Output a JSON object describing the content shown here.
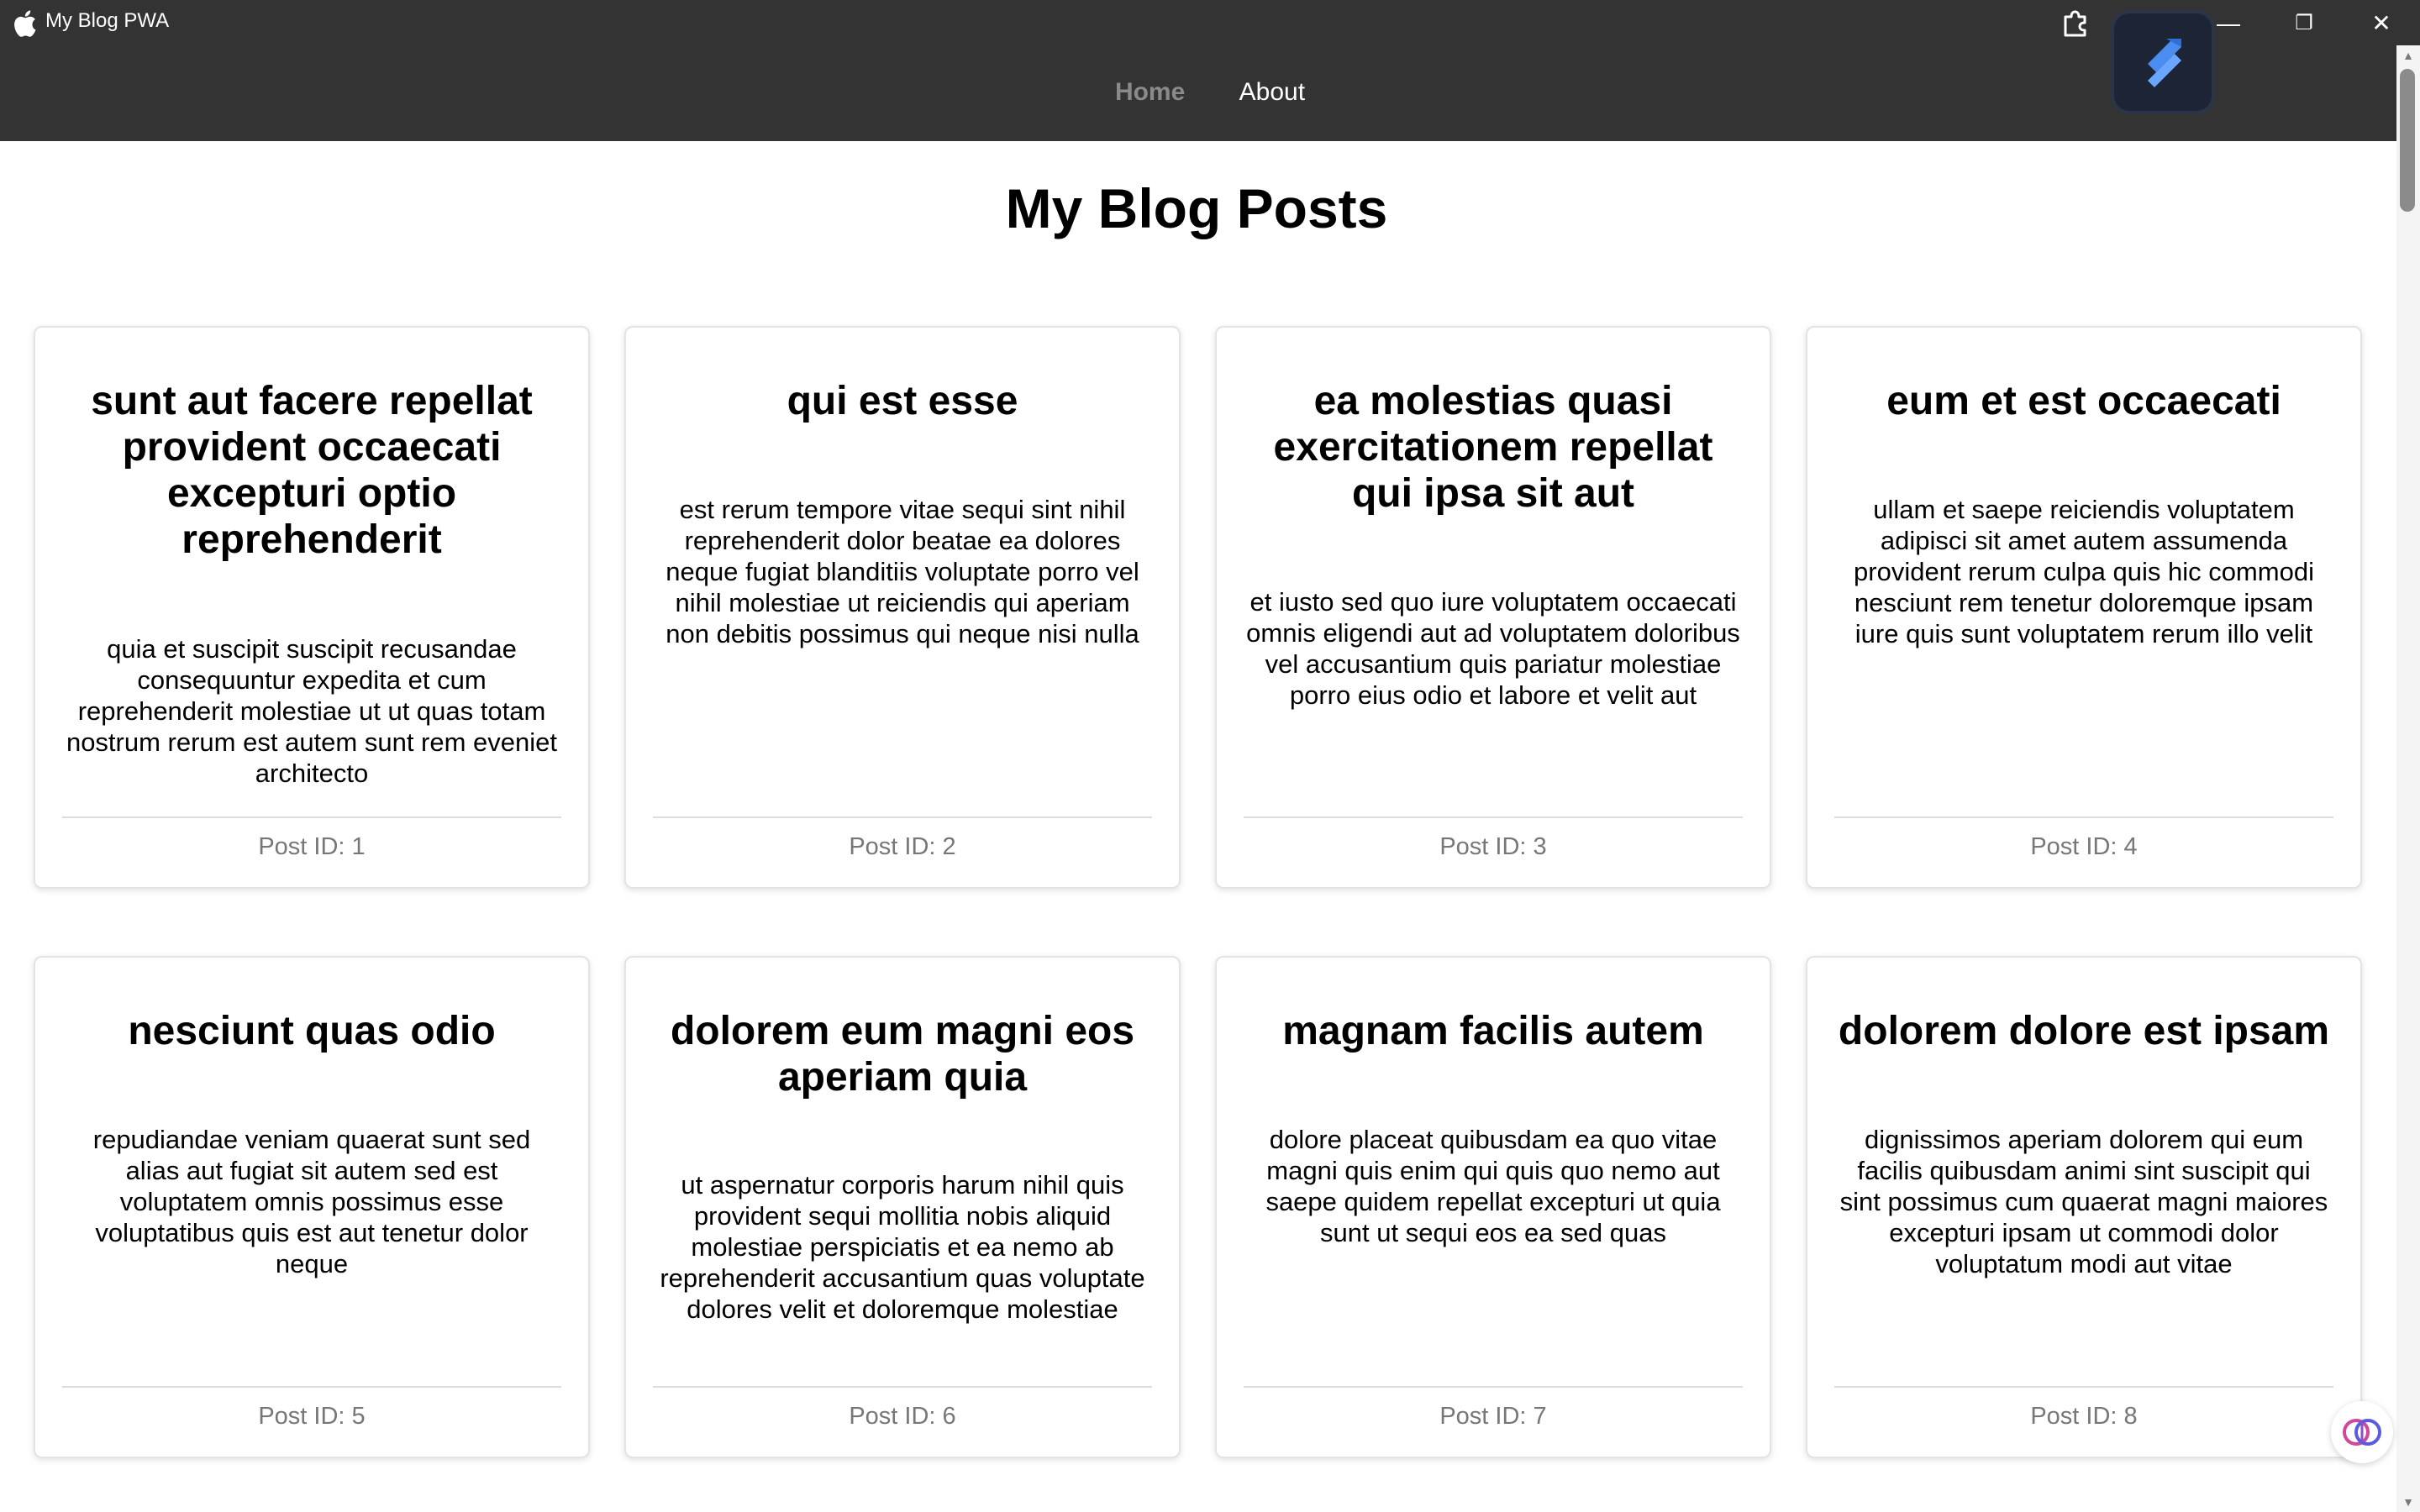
{
  "window": {
    "title": "My Blog PWA",
    "controls": {
      "minimize": "—",
      "restore": "❐",
      "close": "✕"
    }
  },
  "nav": {
    "items": [
      {
        "label": "Home",
        "active": true
      },
      {
        "label": "About",
        "active": false
      }
    ]
  },
  "page": {
    "title": "My Blog Posts"
  },
  "posts": [
    {
      "title": "sunt aut facere repellat provident occaecati excepturi optio reprehenderit",
      "body": "quia et suscipit suscipit recusandae consequuntur expedita et cum reprehenderit molestiae ut ut quas totam nostrum rerum est autem sunt rem eveniet architecto",
      "id_label": "Post ID: 1"
    },
    {
      "title": "qui est esse",
      "body": "est rerum tempore vitae sequi sint nihil reprehenderit dolor beatae ea dolores neque fugiat blanditiis voluptate porro vel nihil molestiae ut reiciendis qui aperiam non debitis possimus qui neque nisi nulla",
      "id_label": "Post ID: 2"
    },
    {
      "title": "ea molestias quasi exercitationem repellat qui ipsa sit aut",
      "body": "et iusto sed quo iure voluptatem occaecati omnis eligendi aut ad voluptatem doloribus vel accusantium quis pariatur molestiae porro eius odio et labore et velit aut",
      "id_label": "Post ID: 3"
    },
    {
      "title": "eum et est occaecati",
      "body": "ullam et saepe reiciendis voluptatem adipisci sit amet autem assumenda provident rerum culpa quis hic commodi nesciunt rem tenetur doloremque ipsam iure quis sunt voluptatem rerum illo velit",
      "id_label": "Post ID: 4"
    },
    {
      "title": "nesciunt quas odio",
      "body": "repudiandae veniam quaerat sunt sed alias aut fugiat sit autem sed est voluptatem omnis possimus esse voluptatibus quis est aut tenetur dolor neque",
      "id_label": "Post ID: 5"
    },
    {
      "title": "dolorem eum magni eos aperiam quia",
      "body": "ut aspernatur corporis harum nihil quis provident sequi mollitia nobis aliquid molestiae perspiciatis et ea nemo ab reprehenderit accusantium quas voluptate dolores velit et doloremque molestiae",
      "id_label": "Post ID: 6"
    },
    {
      "title": "magnam facilis autem",
      "body": "dolore placeat quibusdam ea quo vitae magni quis enim qui quis quo nemo aut saepe quidem repellat excepturi ut quia sunt ut sequi eos ea sed quas",
      "id_label": "Post ID: 7"
    },
    {
      "title": "dolorem dolore est ipsam",
      "body": "dignissimos aperiam dolorem qui eum facilis quibusdam animi sint suscipit qui sint possimus cum quaerat magni maiores excepturi ipsam ut commodi dolor voluptatum modi aut vitae",
      "id_label": "Post ID: 8"
    }
  ],
  "icons": {
    "app": "apple-logo-icon",
    "extension": "puzzle-extension-icon",
    "badge": "app-badge-icon",
    "assistant": "brain-assistant-icon"
  },
  "colors": {
    "titlebar_bg": "#333333",
    "nav_active": "#8a8a8a",
    "nav_inactive": "#ffffff",
    "post_id": "#777777"
  }
}
